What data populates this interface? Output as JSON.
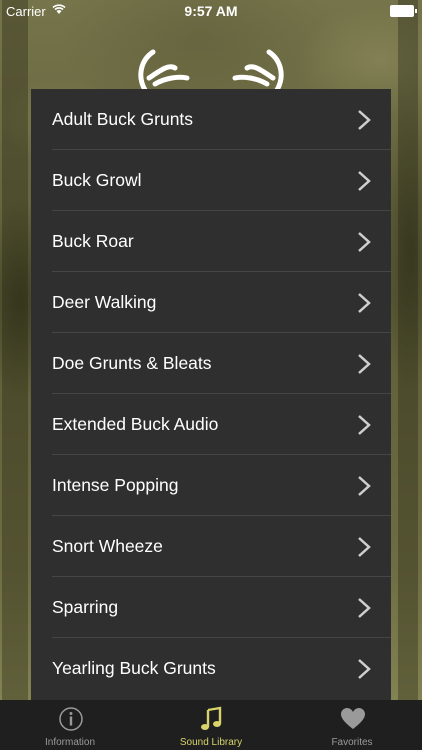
{
  "status_bar": {
    "carrier": "Carrier",
    "time": "9:57 AM"
  },
  "list": {
    "items": [
      {
        "label": "Adult Buck Grunts"
      },
      {
        "label": "Buck Growl"
      },
      {
        "label": "Buck Roar"
      },
      {
        "label": "Deer Walking"
      },
      {
        "label": "Doe Grunts & Bleats"
      },
      {
        "label": "Extended Buck Audio"
      },
      {
        "label": "Intense Popping"
      },
      {
        "label": "Snort Wheeze"
      },
      {
        "label": "Sparring"
      },
      {
        "label": "Yearling Buck Grunts"
      }
    ]
  },
  "tab_bar": {
    "tabs": [
      {
        "label": "Information",
        "icon": "info-icon",
        "active": false
      },
      {
        "label": "Sound Library",
        "icon": "music-note-icon",
        "active": true
      },
      {
        "label": "Favorites",
        "icon": "heart-icon",
        "active": false
      }
    ]
  },
  "colors": {
    "accent": "#d8d36a",
    "panel": "#2f2f2f",
    "tabbar": "#1f1f1f"
  }
}
